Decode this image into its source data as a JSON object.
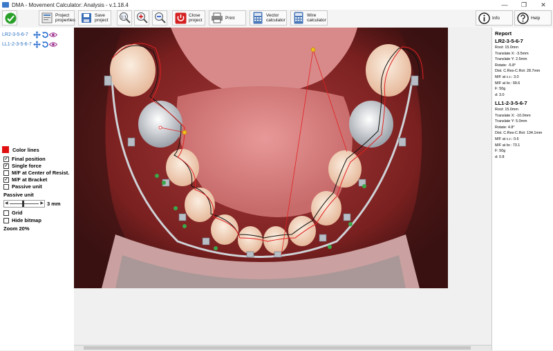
{
  "window": {
    "title": "DMA - Movement Calculator: Analysis - v.1.18.4",
    "controls": [
      "—",
      "❐",
      "✕"
    ]
  },
  "toolbar": {
    "project_properties": "Project\nproperties",
    "save_project": "Save\nproject",
    "zoom_fit": "1:1",
    "close_project": "Close\nproject",
    "print": "Print",
    "vector_calculator": "Vector\ncalculator",
    "wire_calculator": "Wire\ncalculator",
    "info": "Info",
    "help": "Help"
  },
  "left_panel": {
    "tooth_groups": [
      {
        "label": "LR2-3-5-6-7"
      },
      {
        "label": "LL1-2-3-5-6-7"
      }
    ],
    "color_lines": "Color lines",
    "color_lines_swatch": "#e01010",
    "options": [
      {
        "label": "Final position",
        "checked": true
      },
      {
        "label": "Single force",
        "checked": true
      },
      {
        "label": "M/F at Center of Resist.",
        "checked": false
      },
      {
        "label": "M/F at Bracket",
        "checked": true
      },
      {
        "label": "Passive unit",
        "checked": false
      }
    ],
    "passive_unit_label": "Passive unit",
    "passive_unit_value": "3 mm",
    "view_options": [
      {
        "label": "Grid",
        "checked": false
      },
      {
        "label": "Hide bitmap",
        "checked": false
      }
    ],
    "zoom": "Zoom 20%"
  },
  "report": {
    "title": "Report",
    "blocks": [
      {
        "heading": "LR2-3-5-6-7",
        "lines": [
          "Root: 15.0mm",
          "Translate X: -3.5mm",
          "Translate Y: 2.5mm",
          "Rotate: -5.8°",
          "Dist. C.Res-C.Rot: 28.7mm",
          "M/F at c.r.: 3.0",
          "M/F at br.: 99.6",
          "F: 50g",
          "d: 3.0"
        ]
      },
      {
        "heading": "LL1-2-3-5-6-7",
        "lines": [
          "Root: 15.0mm",
          "Translate X: -10.0mm",
          "Translate Y: 5.0mm",
          "Rotate: 4.8°",
          "Dist. C.Res-C.Rot: 134.1mm",
          "M/F at c.r.: 0.6",
          "M/F at br.: 73.1",
          "F: 50g",
          "d: 0.8"
        ]
      }
    ]
  }
}
